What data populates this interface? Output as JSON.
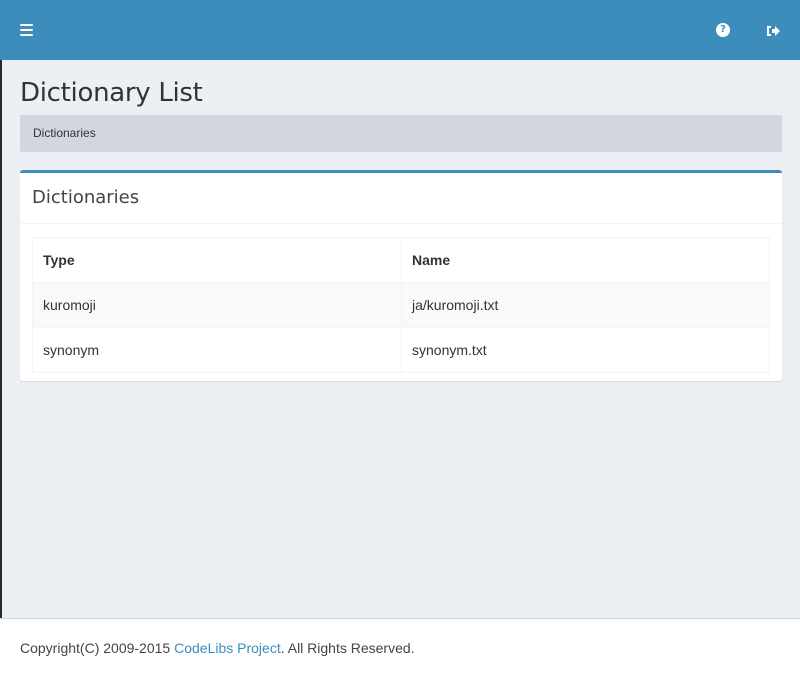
{
  "header": {
    "menu_icon": "bars-icon",
    "help_icon": "question-circle-icon",
    "help_glyph": "?",
    "logout_icon": "sign-out-icon"
  },
  "page": {
    "title": "Dictionary List",
    "breadcrumb": "Dictionaries"
  },
  "box": {
    "title": "Dictionaries",
    "columns": [
      "Type",
      "Name"
    ],
    "rows": [
      {
        "type": "kuromoji",
        "name": "ja/kuromoji.txt"
      },
      {
        "type": "synonym",
        "name": "synonym.txt"
      }
    ]
  },
  "footer": {
    "prefix": "Copyright(C) 2009-2015 ",
    "link_text": "CodeLibs Project",
    "suffix": ". All Rights Reserved."
  },
  "colors": {
    "accent": "#3c8dbc",
    "background": "#ecf0f5",
    "breadcrumb_bg": "#d2d6de"
  }
}
